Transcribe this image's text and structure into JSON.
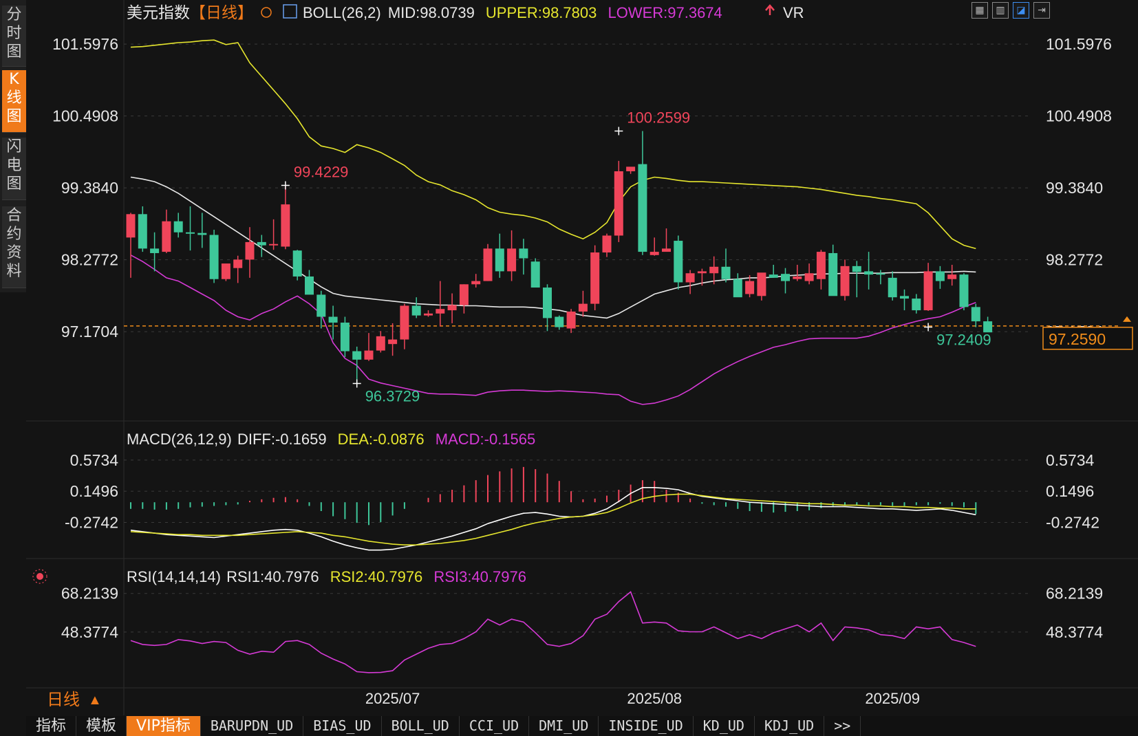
{
  "sidebar": {
    "tabs": [
      {
        "label": "分\n时\n图",
        "active": false
      },
      {
        "label": "K\n线\n图",
        "active": true
      },
      {
        "label": "闪\n电\n图",
        "active": false
      },
      {
        "label": "合\n约\n资\n料",
        "active": false
      }
    ]
  },
  "toolbar_icons": [
    "grid-icon",
    "layout-icon",
    "chart-type-icon",
    "expand-icon"
  ],
  "header": {
    "title": "美元指数",
    "period": "【日线】",
    "boll_label": "BOLL(26,2)",
    "mid": "MID:98.0739",
    "upper": "UPPER:98.7803",
    "lower": "LOWER:97.3674",
    "vr": "VR",
    "colors": {
      "title": "#e8e8e8",
      "period": "#f07a1a",
      "upper": "#e6e62e",
      "lower": "#d63ad6",
      "mid": "#e8e8e8"
    }
  },
  "macd_header": {
    "label": "MACD(26,12,9)",
    "diff": "DIFF:-0.1659",
    "dea": "DEA:-0.0876",
    "macd": "MACD:-0.1565"
  },
  "rsi_header": {
    "label": "RSI(14,14,14)",
    "rsi1": "RSI1:40.7976",
    "rsi2": "RSI2:40.7976",
    "rsi3": "RSI3:40.7976"
  },
  "period_selector": {
    "label": "日线",
    "arrow": "▲"
  },
  "bottom_tabs": [
    {
      "label": "指标",
      "active": false
    },
    {
      "label": "模板",
      "active": false
    },
    {
      "label": "VIP指标",
      "active": true
    },
    {
      "label": "BARUPDN_UD",
      "active": false
    },
    {
      "label": "BIAS_UD",
      "active": false
    },
    {
      "label": "BOLL_UD",
      "active": false
    },
    {
      "label": "CCI_UD",
      "active": false
    },
    {
      "label": "DMI_UD",
      "active": false
    },
    {
      "label": "INSIDE_UD",
      "active": false
    },
    {
      "label": "KD_UD",
      "active": false
    },
    {
      "label": "KDJ_UD",
      "active": false
    },
    {
      "label": ">>",
      "active": false
    }
  ],
  "chart_data": [
    {
      "type": "candlestick",
      "title": "美元指数【日线】",
      "ylim": [
        95.87,
        101.8
      ],
      "y_ticks": [
        "101.5976",
        "100.4908",
        "99.3840",
        "98.2772",
        "97.1704"
      ],
      "x_ticks": [
        "2025/07",
        "2025/08",
        "2025/09"
      ],
      "x_tick_index": [
        22,
        44,
        64
      ],
      "last_price": "97.2590",
      "last_price_value": 97.259,
      "annotations": [
        {
          "text": "99.4229",
          "index": 13,
          "value": 99.4229,
          "kind": "high"
        },
        {
          "text": "96.3729",
          "index": 19,
          "value": 96.3729,
          "kind": "low"
        },
        {
          "text": "100.2599",
          "index": 41,
          "value": 100.2599,
          "kind": "high"
        },
        {
          "text": "97.2409",
          "index": 67,
          "value": 97.2409,
          "kind": "low"
        }
      ],
      "candles": [
        [
          98.62,
          99.0,
          98.0,
          98.98
        ],
        [
          98.98,
          99.1,
          98.4,
          98.45
        ],
        [
          98.45,
          98.7,
          98.1,
          98.38
        ],
        [
          98.4,
          99.05,
          98.38,
          98.87
        ],
        [
          98.87,
          99.0,
          98.62,
          98.7
        ],
        [
          98.7,
          99.1,
          98.42,
          98.69
        ],
        [
          98.69,
          99.0,
          98.46,
          98.66
        ],
        [
          98.66,
          98.74,
          97.92,
          97.98
        ],
        [
          97.98,
          98.15,
          97.95,
          98.22
        ],
        [
          98.15,
          98.34,
          97.92,
          98.28
        ],
        [
          98.28,
          98.78,
          98.0,
          98.55
        ],
        [
          98.55,
          98.66,
          98.32,
          98.5
        ],
        [
          98.5,
          98.9,
          98.43,
          98.52
        ],
        [
          98.48,
          99.4229,
          98.44,
          99.13
        ],
        [
          98.42,
          98.43,
          97.96,
          98.02
        ],
        [
          98.02,
          98.12,
          97.76,
          97.74
        ],
        [
          97.74,
          97.8,
          97.22,
          97.4
        ],
        [
          97.4,
          97.57,
          97.05,
          97.31
        ],
        [
          97.31,
          97.4,
          96.78,
          96.87
        ],
        [
          96.87,
          96.94,
          96.3729,
          96.74
        ],
        [
          96.74,
          97.15,
          96.72,
          96.88
        ],
        [
          96.88,
          97.18,
          96.85,
          97.1
        ],
        [
          96.98,
          97.3,
          96.8,
          97.05
        ],
        [
          97.05,
          97.6,
          96.9,
          97.57
        ],
        [
          97.57,
          97.7,
          97.38,
          97.42
        ],
        [
          97.42,
          97.5,
          97.4,
          97.45
        ],
        [
          97.45,
          97.95,
          97.25,
          97.52
        ],
        [
          97.5,
          97.76,
          97.3,
          97.58
        ],
        [
          97.58,
          97.9,
          97.45,
          97.9
        ],
        [
          97.9,
          98.06,
          97.85,
          97.95
        ],
        [
          97.95,
          98.52,
          97.95,
          98.45
        ],
        [
          98.45,
          98.68,
          98.0,
          98.1
        ],
        [
          98.1,
          98.73,
          97.95,
          98.45
        ],
        [
          98.45,
          98.6,
          98.05,
          98.3
        ],
        [
          98.25,
          98.3,
          97.88,
          97.85
        ],
        [
          97.85,
          97.9,
          97.18,
          97.38
        ],
        [
          97.4,
          97.42,
          97.2,
          97.24
        ],
        [
          97.22,
          97.52,
          97.15,
          97.48
        ],
        [
          97.48,
          97.8,
          97.4,
          97.6
        ],
        [
          97.6,
          98.5,
          97.5,
          98.39
        ],
        [
          98.39,
          98.68,
          98.32,
          98.65
        ],
        [
          98.65,
          99.8,
          98.55,
          99.64
        ],
        [
          99.64,
          99.7,
          99.6,
          99.71
        ],
        [
          99.75,
          100.2599,
          98.35,
          98.4
        ],
        [
          98.35,
          98.62,
          98.34,
          98.4
        ],
        [
          98.4,
          98.76,
          98.42,
          98.45
        ],
        [
          98.57,
          98.65,
          97.82,
          97.93
        ],
        [
          97.93,
          98.12,
          97.75,
          98.07
        ],
        [
          98.07,
          98.14,
          97.88,
          98.1
        ],
        [
          98.07,
          98.33,
          97.9,
          98.17
        ],
        [
          98.17,
          98.45,
          97.93,
          97.98
        ],
        [
          97.98,
          98.07,
          97.77,
          97.7
        ],
        [
          97.75,
          98.04,
          97.7,
          97.95
        ],
        [
          97.72,
          98.0,
          97.65,
          98.08
        ],
        [
          98.05,
          98.2,
          98.05,
          98.0
        ],
        [
          98.06,
          98.15,
          97.76,
          97.95
        ],
        [
          97.98,
          98.2,
          97.95,
          98.02
        ],
        [
          97.95,
          98.22,
          97.9,
          98.07
        ],
        [
          97.98,
          98.43,
          97.82,
          98.4
        ],
        [
          98.38,
          98.51,
          97.87,
          97.72
        ],
        [
          97.72,
          98.28,
          97.65,
          98.18
        ],
        [
          98.18,
          98.26,
          97.7,
          98.09
        ],
        [
          98.1,
          98.4,
          97.82,
          98.05
        ],
        [
          98.07,
          98.12,
          97.9,
          98.05
        ],
        [
          98.0,
          98.1,
          97.65,
          97.7
        ],
        [
          97.72,
          97.82,
          97.5,
          97.68
        ],
        [
          97.68,
          97.75,
          97.45,
          97.5
        ],
        [
          97.5,
          98.23,
          97.49,
          98.1
        ],
        [
          98.1,
          98.18,
          97.83,
          97.95
        ],
        [
          97.98,
          98.2,
          97.88,
          98.05
        ],
        [
          98.05,
          98.07,
          97.5,
          97.55
        ],
        [
          97.55,
          97.6,
          97.24,
          97.33
        ],
        [
          97.33,
          97.4,
          97.24,
          97.16
        ]
      ],
      "mid": [
        99.55,
        99.52,
        99.48,
        99.4,
        99.3,
        99.18,
        99.06,
        98.94,
        98.82,
        98.7,
        98.58,
        98.46,
        98.34,
        98.22,
        98.1,
        97.98,
        97.86,
        97.76,
        97.72,
        97.7,
        97.68,
        97.66,
        97.64,
        97.62,
        97.6,
        97.59,
        97.58,
        97.58,
        97.57,
        97.57,
        97.56,
        97.55,
        97.55,
        97.55,
        97.54,
        97.52,
        97.5,
        97.46,
        97.42,
        97.4,
        97.38,
        97.45,
        97.55,
        97.65,
        97.75,
        97.8,
        97.85,
        97.88,
        97.92,
        97.95,
        97.97,
        97.98,
        98.0,
        98.0,
        98.01,
        98.03,
        98.04,
        98.05,
        98.06,
        98.06,
        98.07,
        98.07,
        98.07,
        98.07,
        98.08,
        98.08,
        98.08,
        98.09,
        98.09,
        98.09,
        98.1,
        98.09
      ],
      "upper": [
        101.55,
        101.56,
        101.58,
        101.6,
        101.62,
        101.63,
        101.65,
        101.66,
        101.59,
        101.62,
        101.31,
        101.1,
        100.89,
        100.68,
        100.45,
        100.17,
        100.03,
        99.99,
        99.93,
        100.05,
        100.0,
        99.93,
        99.83,
        99.73,
        99.58,
        99.48,
        99.43,
        99.34,
        99.28,
        99.2,
        99.08,
        99.01,
        98.98,
        98.96,
        98.92,
        98.86,
        98.75,
        98.67,
        98.6,
        98.7,
        98.85,
        99.17,
        99.4,
        99.5,
        99.55,
        99.53,
        99.5,
        99.48,
        99.48,
        99.47,
        99.46,
        99.45,
        99.44,
        99.43,
        99.42,
        99.41,
        99.4,
        99.38,
        99.36,
        99.33,
        99.3,
        99.27,
        99.25,
        99.22,
        99.2,
        99.17,
        99.14,
        99.0,
        98.8,
        98.6,
        98.5,
        98.45
      ],
      "lower": [
        98.35,
        98.25,
        98.13,
        98.0,
        97.95,
        97.85,
        97.75,
        97.65,
        97.5,
        97.4,
        97.35,
        97.45,
        97.52,
        97.63,
        97.72,
        97.6,
        97.44,
        97.0,
        96.76,
        96.65,
        96.44,
        96.38,
        96.34,
        96.3,
        96.26,
        96.22,
        96.21,
        96.21,
        96.2,
        96.19,
        96.24,
        96.26,
        96.27,
        96.27,
        96.26,
        96.25,
        96.26,
        96.25,
        96.24,
        96.23,
        96.21,
        96.2,
        96.1,
        96.05,
        96.07,
        96.12,
        96.18,
        96.28,
        96.4,
        96.52,
        96.62,
        96.71,
        96.79,
        96.86,
        96.93,
        96.97,
        97.02,
        97.06,
        97.07,
        97.07,
        97.07,
        97.07,
        97.1,
        97.16,
        97.23,
        97.28,
        97.33,
        97.37,
        97.4,
        97.47,
        97.55,
        97.62
      ]
    },
    {
      "type": "line",
      "title": "MACD(26,12,9)",
      "ylim": [
        -0.7,
        0.75
      ],
      "y_ticks": [
        "0.5734",
        "0.1496",
        "-0.2742"
      ],
      "diff": [
        -0.38,
        -0.4,
        -0.42,
        -0.44,
        -0.45,
        -0.46,
        -0.47,
        -0.48,
        -0.46,
        -0.44,
        -0.42,
        -0.4,
        -0.38,
        -0.37,
        -0.38,
        -0.42,
        -0.47,
        -0.53,
        -0.58,
        -0.62,
        -0.65,
        -0.65,
        -0.64,
        -0.61,
        -0.58,
        -0.54,
        -0.5,
        -0.46,
        -0.41,
        -0.36,
        -0.29,
        -0.24,
        -0.19,
        -0.15,
        -0.14,
        -0.16,
        -0.19,
        -0.2,
        -0.19,
        -0.15,
        -0.09,
        0.01,
        0.12,
        0.2,
        0.2,
        0.19,
        0.17,
        0.12,
        0.08,
        0.06,
        0.04,
        0.02,
        0.0,
        -0.01,
        -0.02,
        -0.03,
        -0.04,
        -0.05,
        -0.06,
        -0.06,
        -0.06,
        -0.07,
        -0.08,
        -0.09,
        -0.09,
        -0.1,
        -0.11,
        -0.1,
        -0.09,
        -0.11,
        -0.14,
        -0.17
      ],
      "dea": [
        -0.4,
        -0.41,
        -0.42,
        -0.43,
        -0.44,
        -0.44,
        -0.45,
        -0.45,
        -0.45,
        -0.45,
        -0.44,
        -0.43,
        -0.42,
        -0.41,
        -0.4,
        -0.41,
        -0.42,
        -0.45,
        -0.47,
        -0.5,
        -0.53,
        -0.55,
        -0.57,
        -0.58,
        -0.58,
        -0.57,
        -0.56,
        -0.54,
        -0.52,
        -0.49,
        -0.45,
        -0.41,
        -0.37,
        -0.32,
        -0.28,
        -0.25,
        -0.22,
        -0.2,
        -0.19,
        -0.17,
        -0.14,
        -0.08,
        -0.01,
        0.05,
        0.08,
        0.1,
        0.11,
        0.11,
        0.09,
        0.07,
        0.05,
        0.04,
        0.03,
        0.02,
        0.01,
        0.0,
        -0.01,
        -0.02,
        -0.02,
        -0.03,
        -0.04,
        -0.04,
        -0.05,
        -0.05,
        -0.06,
        -0.06,
        -0.07,
        -0.07,
        -0.08,
        -0.08,
        -0.09,
        -0.09
      ],
      "hist": [
        -0.09,
        -0.09,
        -0.1,
        -0.1,
        -0.09,
        -0.07,
        -0.06,
        -0.05,
        -0.04,
        -0.03,
        0.02,
        0.04,
        0.06,
        0.07,
        0.04,
        -0.05,
        -0.12,
        -0.19,
        -0.23,
        -0.28,
        -0.31,
        -0.27,
        -0.18,
        -0.09,
        0.0,
        0.06,
        0.11,
        0.17,
        0.23,
        0.3,
        0.37,
        0.42,
        0.46,
        0.48,
        0.45,
        0.39,
        0.29,
        0.15,
        0.04,
        0.05,
        0.09,
        0.17,
        0.24,
        0.3,
        0.29,
        0.17,
        0.13,
        0.05,
        -0.02,
        -0.04,
        -0.06,
        -0.09,
        -0.12,
        -0.13,
        -0.14,
        -0.13,
        -0.12,
        -0.11,
        -0.08,
        -0.05,
        -0.04,
        -0.04,
        -0.04,
        -0.04,
        -0.05,
        -0.05,
        -0.04,
        -0.04,
        -0.02,
        -0.05,
        -0.07,
        -0.16
      ]
    },
    {
      "type": "line",
      "title": "RSI(14,14,14)",
      "ylim": [
        25,
        78
      ],
      "y_ticks": [
        "68.2139",
        "48.3774"
      ],
      "rsi": [
        44.0,
        42.0,
        41.5,
        42.0,
        44.5,
        43.8,
        42.5,
        43.5,
        43.0,
        39.0,
        37.0,
        38.5,
        38.0,
        43.5,
        44.0,
        42.0,
        37.5,
        34.5,
        32.0,
        28.0,
        27.5,
        27.6,
        28.5,
        34.0,
        37.0,
        40.0,
        42.0,
        42.5,
        45.0,
        48.5,
        55.0,
        52.0,
        55.0,
        53.5,
        48.0,
        42.0,
        41.0,
        42.5,
        46.5,
        55.0,
        57.5,
        64.0,
        69.0,
        53.0,
        53.5,
        53.0,
        49.0,
        48.5,
        48.5,
        51.0,
        48.0,
        45.0,
        47.0,
        45.0,
        48.0,
        50.0,
        52.0,
        48.5,
        53.0,
        44.0,
        51.0,
        50.5,
        49.5,
        47.0,
        46.5,
        45.0,
        51.0,
        50.0,
        51.0,
        44.5,
        43.0,
        41.0
      ]
    }
  ]
}
